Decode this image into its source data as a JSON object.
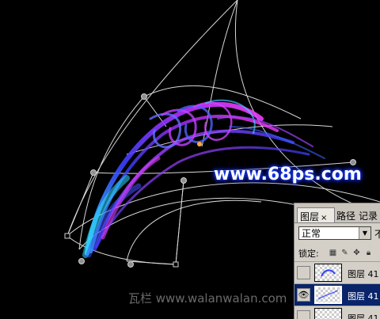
{
  "watermark": "www.68ps.com",
  "bottom_watermark": "瓦栏 www.walanwalan.com",
  "layers_panel": {
    "tabs": [
      {
        "label": "图层",
        "close": "×"
      },
      {
        "label": "路径"
      },
      {
        "label": "记录"
      }
    ],
    "blend_mode": "正常",
    "opacity_label": "不",
    "lock_label": "锁定:",
    "lock_icons": [
      "transparent-lock-icon",
      "brush-lock-icon",
      "move-lock-icon",
      "padlock-icon"
    ],
    "layers": [
      {
        "name": "图层 41",
        "visible": false,
        "selected": false
      },
      {
        "name": "图层 41",
        "visible": true,
        "selected": true
      },
      {
        "name": "图层 41",
        "visible": false,
        "selected": false
      }
    ]
  },
  "colors": {
    "background": "#000000",
    "ribbon_blue": "#2a3cff",
    "ribbon_magenta": "#e030ff",
    "ribbon_cyan": "#40d8ff",
    "selection_blue": "#0a246a",
    "panel_gray": "#d4d0c8"
  }
}
